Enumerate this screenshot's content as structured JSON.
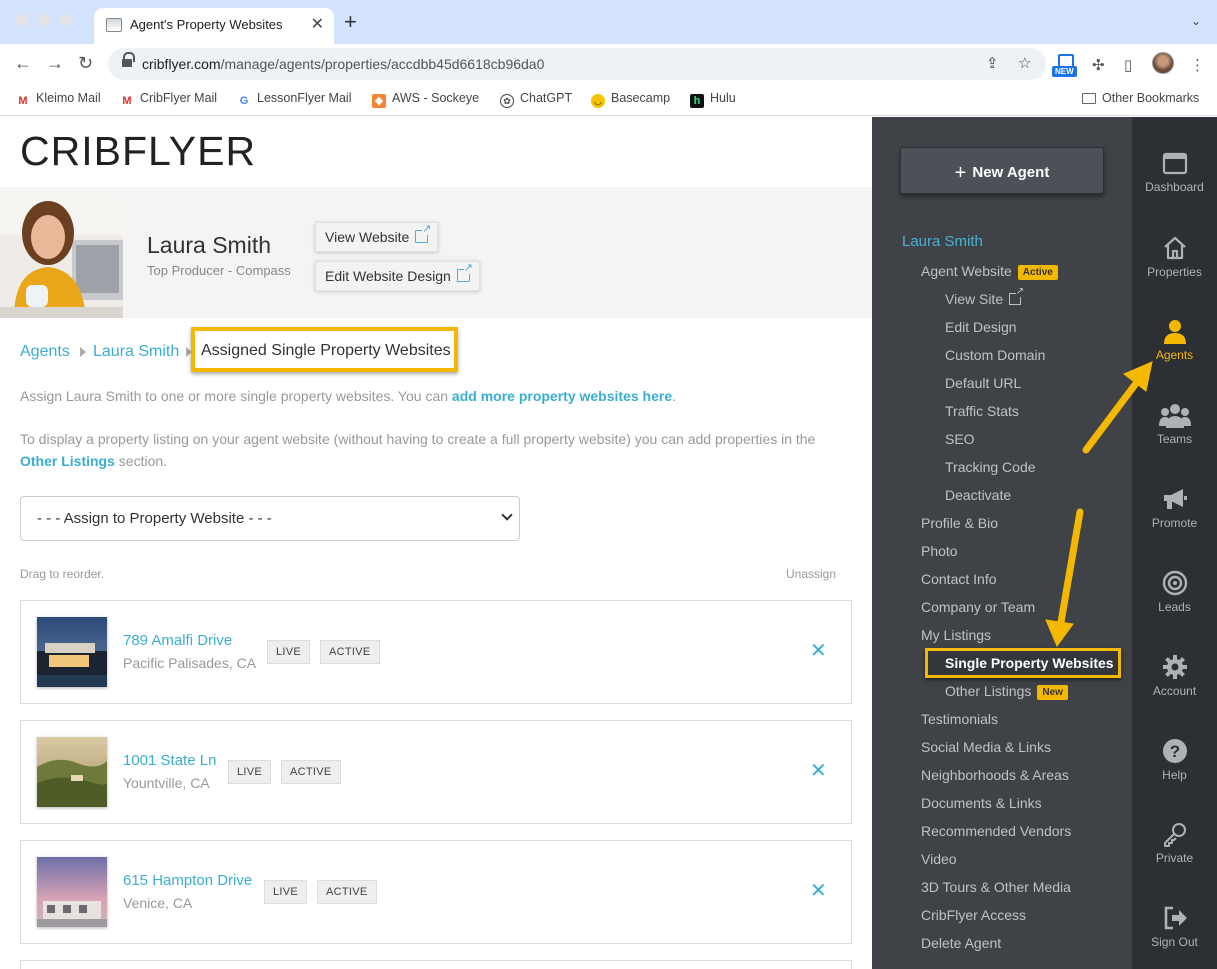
{
  "browser": {
    "tab_title": "Agent's Property Websites",
    "url_host": "cribflyer.com",
    "url_path": "/manage/agents/properties/accdbb45d6618cb96da0",
    "ext_new_badge": "NEW",
    "bookmarks": [
      "Kleimo Mail",
      "CribFlyer Mail",
      "LessonFlyer Mail",
      "AWS - Sockeye",
      "ChatGPT",
      "Basecamp",
      "Hulu"
    ],
    "other_bookmarks": "Other Bookmarks"
  },
  "logo": "CRIBFLYER",
  "agent": {
    "name": "Laura Smith",
    "subtitle": "Top Producer - Compass",
    "view_website": "View Website",
    "edit_design": "Edit Website Design"
  },
  "breadcrumb": {
    "agents": "Agents",
    "agent_name": "Laura Smith",
    "current": "Assigned Single Property Websites"
  },
  "intro": {
    "p1_prefix": "Assign Laura Smith to one or more single property websites. You can ",
    "p1_link": "add more property websites here",
    "p1_suffix": ".",
    "p2_line1": "To display a property listing on your agent website (without having to create a full property website) you can add properties in the",
    "p2_link": "Other Listings",
    "p2_suffix": " section."
  },
  "assign_select": {
    "selected": "- - - Assign to Property Website - - -"
  },
  "list_labels": {
    "drag": "Drag to reorder.",
    "unassign": "Unassign"
  },
  "properties": [
    {
      "title": "789 Amalfi Drive",
      "city": "Pacific Palisades, CA",
      "status_live": "LIVE",
      "status_active": "ACTIVE"
    },
    {
      "title": "1001 State Ln",
      "city": "Yountville, CA",
      "status_live": "LIVE",
      "status_active": "ACTIVE"
    },
    {
      "title": "615 Hampton Drive",
      "city": "Venice, CA",
      "status_live": "LIVE",
      "status_active": "ACTIVE"
    }
  ],
  "sidenav": {
    "new_agent": "New Agent",
    "agent_name": "Laura Smith",
    "agent_website": "Agent Website",
    "active_pill": "Active",
    "sub_items": [
      "View Site",
      "Edit Design",
      "Custom Domain",
      "Default URL",
      "Traffic Stats",
      "SEO",
      "Tracking Code",
      "Deactivate"
    ],
    "items_a": [
      "Profile & Bio",
      "Photo",
      "Contact Info",
      "Company or Team",
      "My Listings"
    ],
    "single_property": "Single Property Websites",
    "other_listings": "Other Listings",
    "new_pill": "New",
    "items_b": [
      "Testimonials",
      "Social Media & Links",
      "Neighborhoods & Areas",
      "Documents & Links",
      "Recommended Vendors",
      "Video",
      "3D Tours & Other Media",
      "CribFlyer Access",
      "Delete Agent"
    ]
  },
  "iconbar": [
    "Dashboard",
    "Properties",
    "Agents",
    "Teams",
    "Promote",
    "Leads",
    "Account",
    "Help",
    "Private",
    "Sign Out"
  ],
  "colors": {
    "accent": "#3aaecf",
    "highlight": "#f5b800",
    "sidebar": "#3f4348",
    "iconbar": "#2c2f33"
  }
}
